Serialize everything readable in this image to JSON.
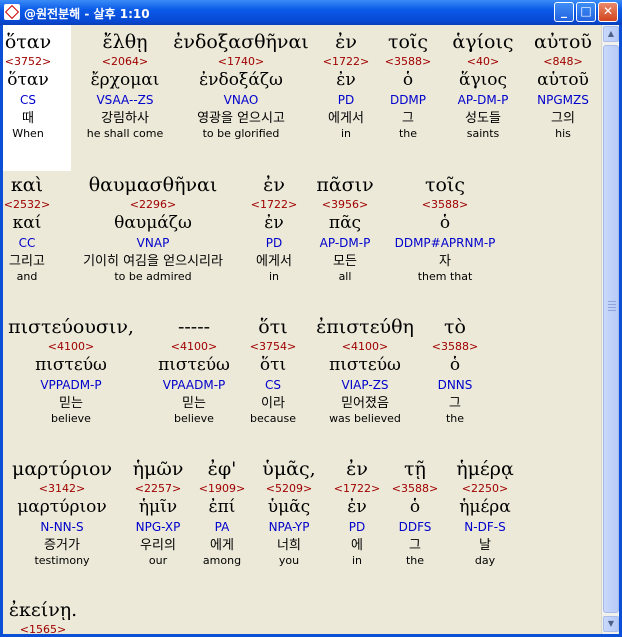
{
  "window": {
    "title": "@원전분해 - 살후 1:10",
    "minimize_glyph": "_",
    "maximize_glyph": "□",
    "close_glyph": "✕"
  },
  "colors": {
    "strong": "#a00000",
    "parse": "#0000cc",
    "highlight": "#ffffff"
  },
  "rows": [
    {
      "words": [
        {
          "greek": "ὅταν",
          "strong": "<3752>",
          "lemma": "ὅταν",
          "parse": "CS",
          "korean": "때",
          "english": "When"
        },
        {
          "greek": "ἔλθῃ",
          "strong": "<2064>",
          "lemma": "ἔρχομαι",
          "parse": "VSAA--ZS",
          "korean": "강림하사",
          "english": "he shall come"
        },
        {
          "greek": "ἐνδοξασθῆναι",
          "strong": "<1740>",
          "lemma": "ἐνδοξάζω",
          "parse": "VNAO",
          "korean": "영광을 얻으시고",
          "english": "to be glorified"
        },
        {
          "greek": "ἐν",
          "strong": "<1722>",
          "lemma": "ἐν",
          "parse": "PD",
          "korean": "에게서",
          "english": "in"
        },
        {
          "greek": "τοῖς",
          "strong": "<3588>",
          "lemma": "ὁ",
          "parse": "DDMP",
          "korean": "그",
          "english": "the"
        },
        {
          "greek": "ἁγίοις",
          "strong": "<40>",
          "lemma": "ἅγιος",
          "parse": "AP-DM-P",
          "korean": "성도들",
          "english": "saints"
        },
        {
          "greek": "αὐτοῦ",
          "strong": "<848>",
          "lemma": "αὑτοῦ",
          "parse": "NPGMZS",
          "korean": "그의",
          "english": "his"
        }
      ]
    },
    {
      "words": [
        {
          "greek": "καὶ",
          "strong": "<2532>",
          "lemma": "καί",
          "parse": "CC",
          "korean": "그리고",
          "english": "and"
        },
        {
          "greek": "θαυμασθῆναι",
          "strong": "<2296>",
          "lemma": "θαυμάζω",
          "parse": "VNAP",
          "korean": "기이히 여김을 얻으시리라",
          "english": "to be admired"
        },
        {
          "greek": "ἐν",
          "strong": "<1722>",
          "lemma": "ἐν",
          "parse": "PD",
          "korean": "에게서",
          "english": "in"
        },
        {
          "greek": "πᾶσιν",
          "strong": "<3956>",
          "lemma": "πᾶς",
          "parse": "AP-DM-P",
          "korean": "모든",
          "english": "all"
        },
        {
          "greek": "τοῖς",
          "strong": "<3588>",
          "lemma": "ὁ",
          "parse": "DDMP#APRNM-P",
          "korean": "자",
          "english": "them that"
        }
      ]
    },
    {
      "words": [
        {
          "greek": "πιστεύουσιν,",
          "strong": "<4100>",
          "lemma": "πιστεύω",
          "parse": "VPPADM-P",
          "korean": "믿는",
          "english": "believe"
        },
        {
          "greek": "-----",
          "strong": "<4100>",
          "lemma": "πιστεύω",
          "parse": "VPAADM-P",
          "korean": "믿는",
          "english": "believe"
        },
        {
          "greek": "ὅτι",
          "strong": "<3754>",
          "lemma": "ὅτι",
          "parse": "CS",
          "korean": "이라",
          "english": "because"
        },
        {
          "greek": "ἐπιστεύθη",
          "strong": "<4100>",
          "lemma": "πιστεύω",
          "parse": "VIAP-ZS",
          "korean": "믿어졌음",
          "english": "was believed"
        },
        {
          "greek": "τὸ",
          "strong": "<3588>",
          "lemma": "ὁ",
          "parse": "DNNS",
          "korean": "그",
          "english": "the"
        }
      ]
    },
    {
      "words": [
        {
          "greek": "μαρτύριον",
          "strong": "<3142>",
          "lemma": "μαρτύριον",
          "parse": "N-NN-S",
          "korean": "증거가",
          "english": "testimony"
        },
        {
          "greek": "ἡμῶν",
          "strong": "<2257>",
          "lemma": "ἡμῖν",
          "parse": "NPG-XP",
          "korean": "우리의",
          "english": "our"
        },
        {
          "greek": "ἐφ'",
          "strong": "<1909>",
          "lemma": "ἐπί",
          "parse": "PA",
          "korean": "에게",
          "english": "among"
        },
        {
          "greek": "ὑμᾶς,",
          "strong": "<5209>",
          "lemma": "ὑμᾶς",
          "parse": "NPA-YP",
          "korean": "너희",
          "english": "you"
        },
        {
          "greek": "ἐν",
          "strong": "<1722>",
          "lemma": "ἐν",
          "parse": "PD",
          "korean": "에",
          "english": "in"
        },
        {
          "greek": "τῇ",
          "strong": "<3588>",
          "lemma": "ὁ",
          "parse": "DDFS",
          "korean": "그",
          "english": "the"
        },
        {
          "greek": "ἡμέρᾳ",
          "strong": "<2250>",
          "lemma": "ἡμέρα",
          "parse": "N-DF-S",
          "korean": "날",
          "english": "day"
        }
      ]
    },
    {
      "words": [
        {
          "greek": "ἐκείνῃ.",
          "strong": "<1565>",
          "lemma": "",
          "parse": "",
          "korean": "",
          "english": ""
        }
      ]
    }
  ]
}
